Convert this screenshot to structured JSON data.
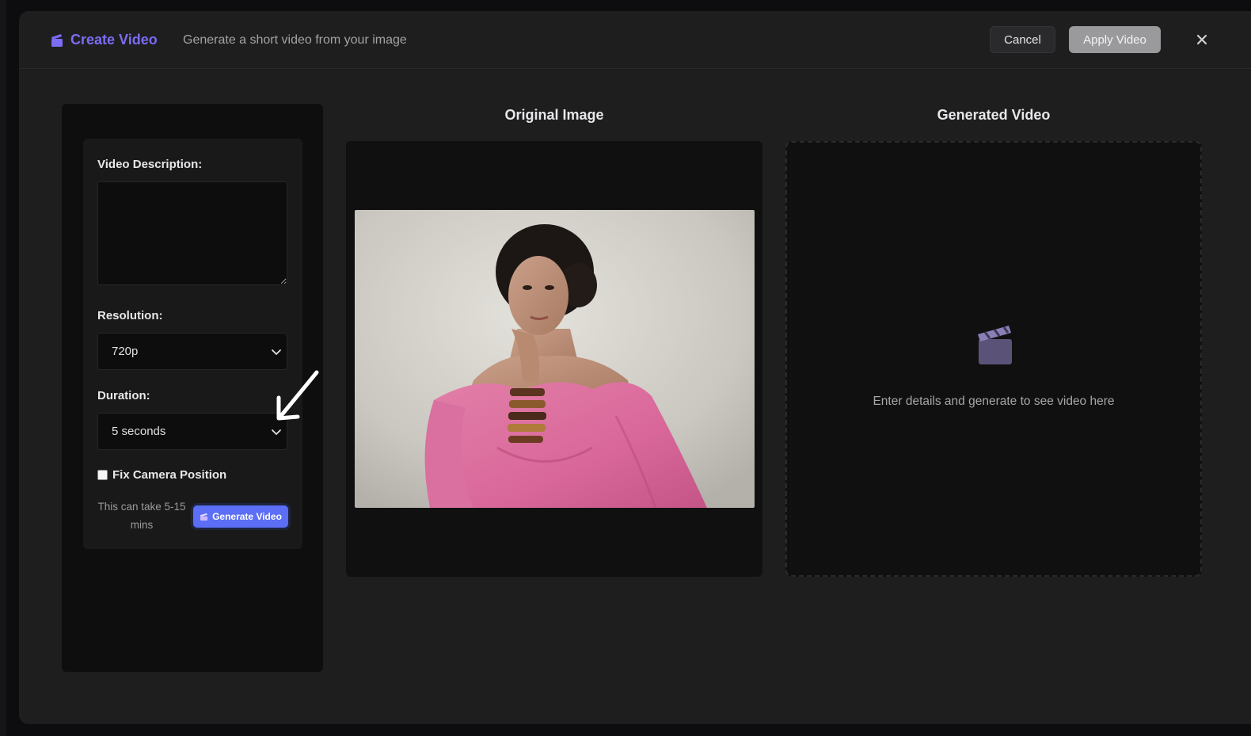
{
  "header": {
    "title": "Create Video",
    "subtitle": "Generate a short video from your image",
    "cancel_label": "Cancel",
    "apply_label": "Apply Video",
    "brand_icon": "clapperboard-icon",
    "close_icon": "close-icon"
  },
  "form": {
    "description_label": "Video Description:",
    "description_value": "",
    "resolution_label": "Resolution:",
    "resolution_value": "720p",
    "duration_label": "Duration:",
    "duration_value": "5 seconds",
    "fix_camera_label": "Fix Camera Position",
    "fix_camera_checked": false,
    "hint": "This can take 5-15 mins",
    "generate_label": "Generate Video"
  },
  "original": {
    "title": "Original Image"
  },
  "generated": {
    "title": "Generated Video",
    "placeholder": "Enter details and generate to see video here",
    "icon": "clapperboard-icon"
  },
  "colors": {
    "accent": "#7c6cf4",
    "generate_button": "#5b6ef5",
    "apply_button": "#9a9a9d"
  }
}
